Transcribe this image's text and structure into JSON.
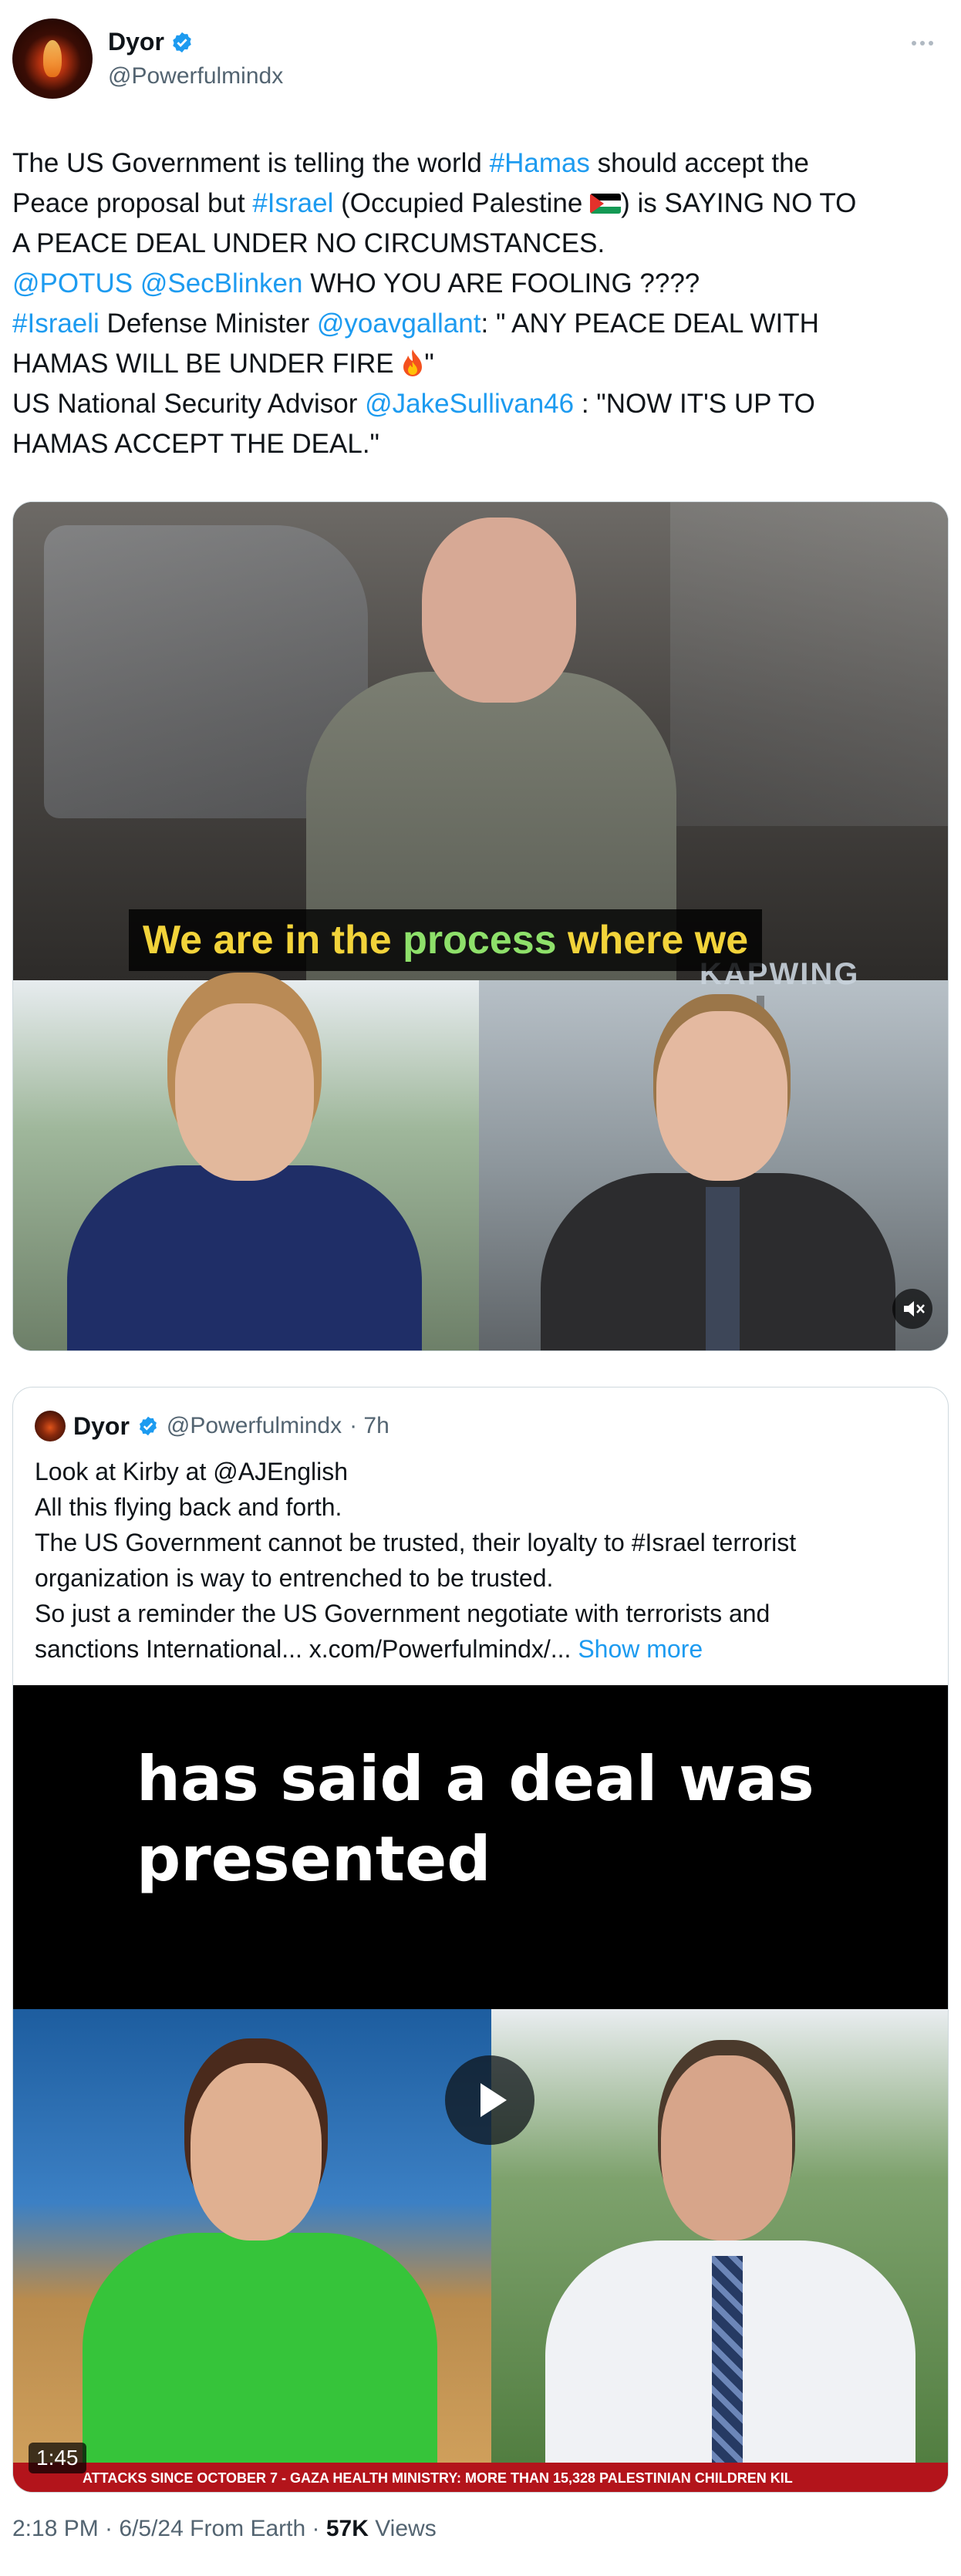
{
  "author": {
    "display_name": "Dyor",
    "handle": "@Powerfulmindx"
  },
  "tweet": {
    "lines": [
      [
        {
          "t": "The US Government is telling the world "
        },
        {
          "t": "#Hamas",
          "link": true
        },
        {
          "t": " should accept the"
        }
      ],
      [
        {
          "t": "Peace proposal  but "
        },
        {
          "t": "#Israel",
          "link": true
        },
        {
          "t": " (Occupied Palestine "
        },
        {
          "t": "",
          "flag": true
        },
        {
          "t": ") is SAYING NO TO"
        }
      ],
      [
        {
          "t": "A PEACE DEAL UNDER NO CIRCUMSTANCES."
        }
      ],
      [
        {
          "t": "@POTUS",
          "link": true
        },
        {
          "t": " "
        },
        {
          "t": "@SecBlinken",
          "link": true
        },
        {
          "t": " WHO YOU ARE FOOLING ????"
        }
      ],
      [
        {
          "t": "#Israeli",
          "link": true
        },
        {
          "t": " Defense Minister "
        },
        {
          "t": "@yoavgallant",
          "link": true
        },
        {
          "t": ": \" ANY PEACE DEAL WITH"
        }
      ],
      [
        {
          "t": "HAMAS WILL BE UNDER FIRE "
        },
        {
          "t": "",
          "fire": true
        },
        {
          "t": "\""
        }
      ],
      [
        {
          "t": "  US National Security Advisor "
        },
        {
          "t": "@JakeSullivan46",
          "link": true
        },
        {
          "t": " : \"NOW IT'S UP TO"
        }
      ],
      [
        {
          "t": "HAMAS ACCEPT THE DEAL.\""
        }
      ]
    ]
  },
  "media": {
    "caption_part1": "We are in the ",
    "caption_part2": "process",
    "caption_part3": " where we",
    "watermark": "KAPWING",
    "mute_icon": "speaker-muted-icon"
  },
  "quote_tweet": {
    "display_name": "Dyor",
    "handle": "@Powerfulmindx",
    "time": "· 7h",
    "lines": [
      "Look at Kirby at @AJEnglish",
      "All this flying back and forth.",
      "The US Government cannot be trusted, their loyalty to #Israel terrorist",
      "organization is way to entrenched to be trusted.",
      "So just a reminder the US Government negotiate with terrorists and",
      "sanctions International... x.com/Powerfulmindx/..."
    ],
    "show_more": "Show more",
    "video": {
      "caption_line1": "has said a deal was",
      "caption_line2": "presented",
      "ticker": "ATTACKS SINCE OCTOBER 7  -  GAZA HEALTH MINISTRY: MORE THAN 15,328 PALESTINIAN CHILDREN KIL",
      "duration": "1:45"
    }
  },
  "footer": {
    "timestamp": "2:18 PM · 6/5/24 From Earth · ",
    "views_count": "57K",
    "views_label": " Views"
  },
  "colors": {
    "link": "#1d9bf0",
    "secondary_text": "#536471",
    "verified": "#1d9bf0"
  }
}
